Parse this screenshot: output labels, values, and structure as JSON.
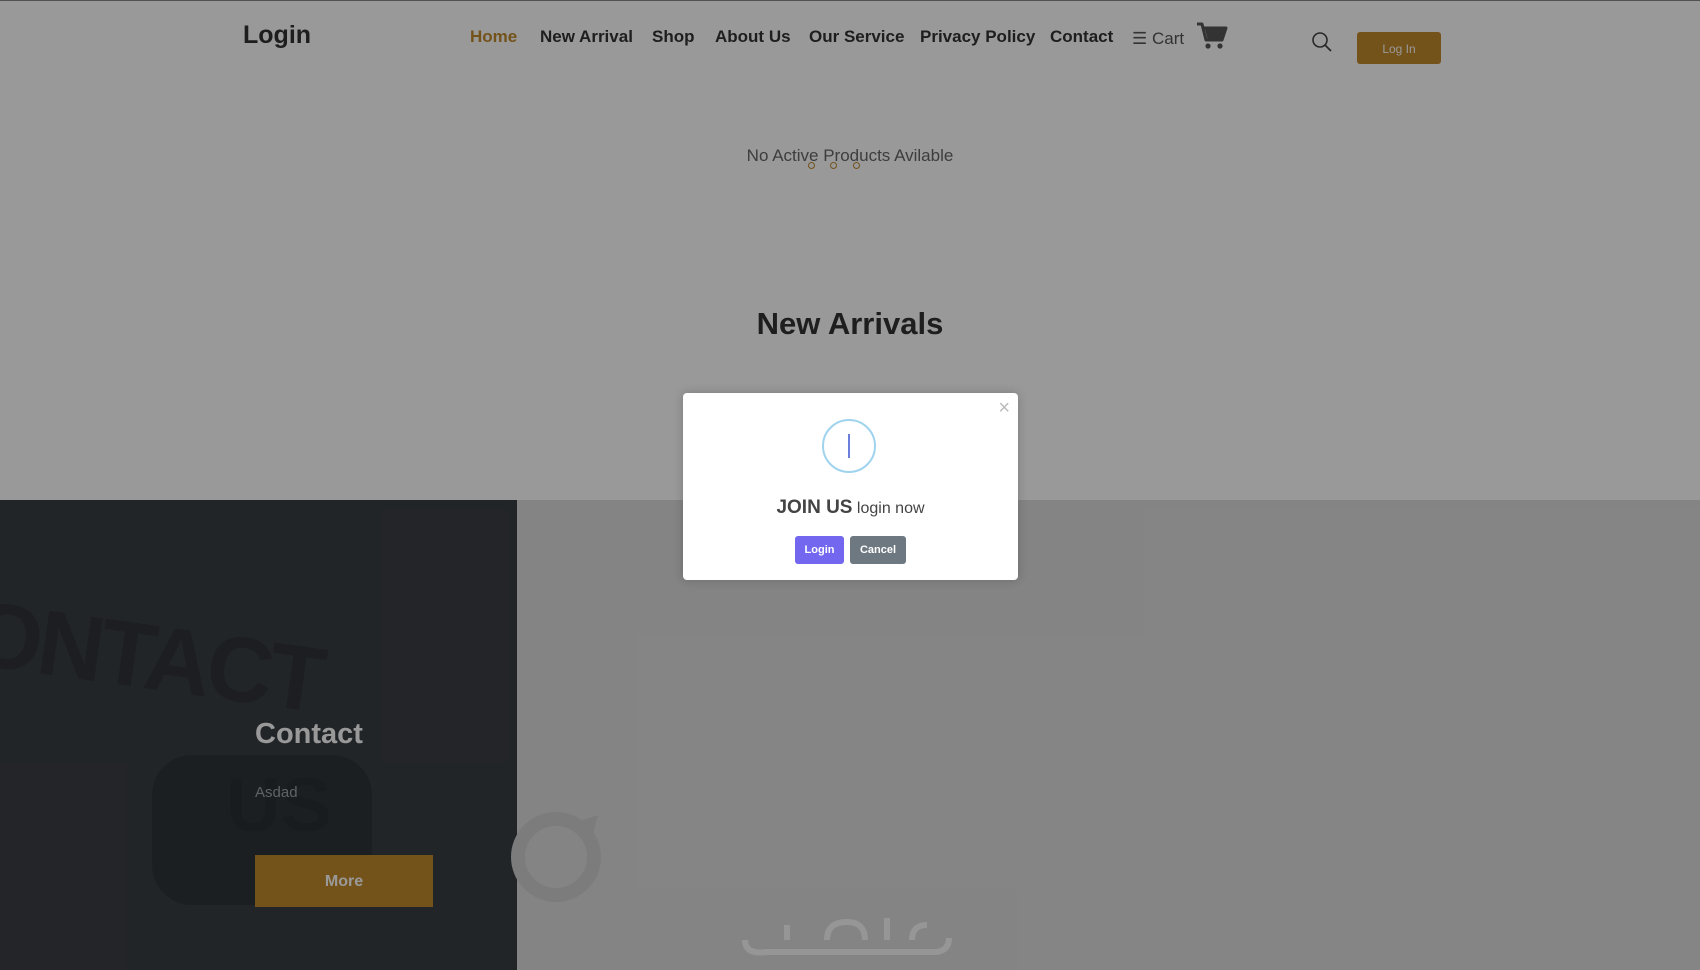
{
  "navbar": {
    "brand": "Login",
    "links": [
      "Home",
      "New Arrival",
      "Shop",
      "About Us",
      "Our Service",
      "Privacy Policy",
      "Contact"
    ],
    "active_link": "Home",
    "cart_label": "☰ Cart",
    "login_button": "Log In"
  },
  "hero": {
    "empty_message": "No Active Products Avilable",
    "section_title": "New Arrivals"
  },
  "contact_section": {
    "background_text": "ONTACT",
    "background_us": "US",
    "title": "Contact",
    "subtitle": "Asdad",
    "more_button": "More"
  },
  "modal": {
    "close_glyph": "×",
    "title_strong": "JOIN US",
    "title_light": " login now",
    "login_button": "Login",
    "cancel_button": "Cancel"
  },
  "colors": {
    "accent": "#c08a2c",
    "modal_login": "#7367f0",
    "modal_cancel": "#6e7881",
    "contact_panel": "#3a3e44"
  }
}
